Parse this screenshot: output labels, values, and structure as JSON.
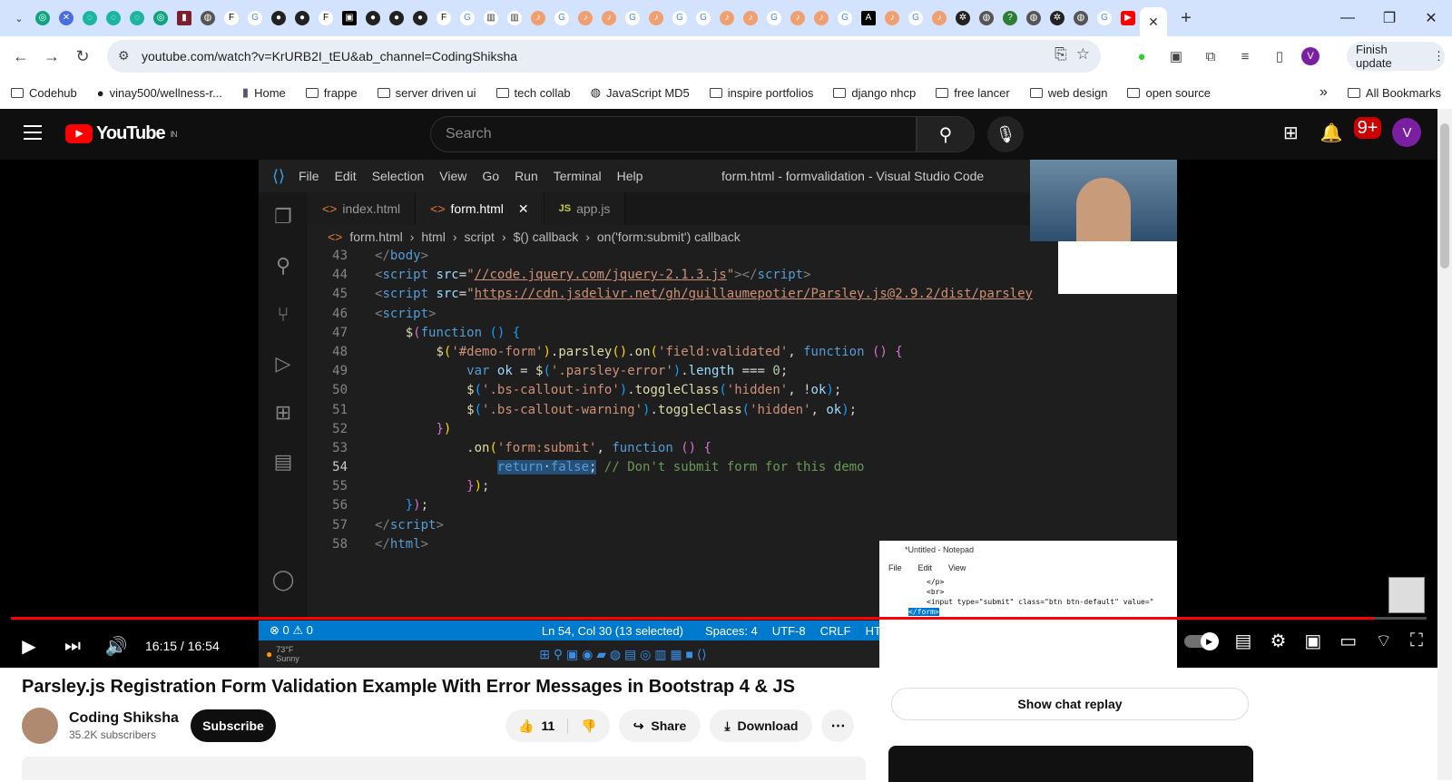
{
  "browser": {
    "url": "youtube.com/watch?v=KrURB2I_tEU&ab_channel=CodingShiksha",
    "finish_update": "Finish update",
    "profile_initial": "V",
    "bookmarks": [
      "Codehub",
      "vinay500/wellness-r...",
      "Home",
      "frappe",
      "server driven ui",
      "tech collab",
      "JavaScript MD5",
      "inspire portfolios",
      "django nhcp",
      "free lancer",
      "web design",
      "open source"
    ],
    "all_bookmarks": "All Bookmarks"
  },
  "youtube": {
    "logo_text": "YouTube",
    "country": "IN",
    "search_placeholder": "Search",
    "notifications": "9+",
    "avatar_initial": "V"
  },
  "vscode": {
    "menu": [
      "File",
      "Edit",
      "Selection",
      "View",
      "Go",
      "Run",
      "Terminal",
      "Help"
    ],
    "title": "form.html - formvalidation - Visual Studio Code",
    "tabs": [
      {
        "label": "index.html",
        "icon": "<>"
      },
      {
        "label": "form.html",
        "icon": "<>"
      },
      {
        "label": "app.js",
        "icon": "JS"
      }
    ],
    "breadcrumb": [
      "form.html",
      "html",
      "script",
      "$() callback",
      "on('form:submit') callback"
    ],
    "line_numbers": [
      "43",
      "44",
      "45",
      "46",
      "47",
      "48",
      "49",
      "50",
      "51",
      "52",
      "53",
      "54",
      "55",
      "56",
      "57",
      "58"
    ],
    "status": {
      "problems": "⊗ 0 ⚠ 0",
      "position": "Ln 54, Col 30 (13 selected)",
      "spaces": "Spaces: 4",
      "encoding": "UTF-8",
      "eol": "CRLF",
      "lang": "HTM"
    },
    "weather": "73°F Sunny"
  },
  "notepad": {
    "title": "*Untitled - Notepad",
    "menu": [
      "File",
      "Edit",
      "View"
    ],
    "lines": [
      "</p>",
      "<br>",
      "<input type=\"submit\" class=\"btn btn-default\" value=\"",
      "</form>"
    ]
  },
  "player": {
    "time": "16:15 / 16:54",
    "progress": 0.963
  },
  "video": {
    "title": "Parsley.js Registration Form Validation Example With Error Messages in Bootstrap 4 & JS",
    "channel": "Coding Shiksha",
    "subscribers": "35.2K subscribers",
    "subscribe": "Subscribe",
    "likes": "11",
    "share": "Share",
    "download": "Download",
    "more": "⋯",
    "chat_replay": "Show chat replay"
  }
}
